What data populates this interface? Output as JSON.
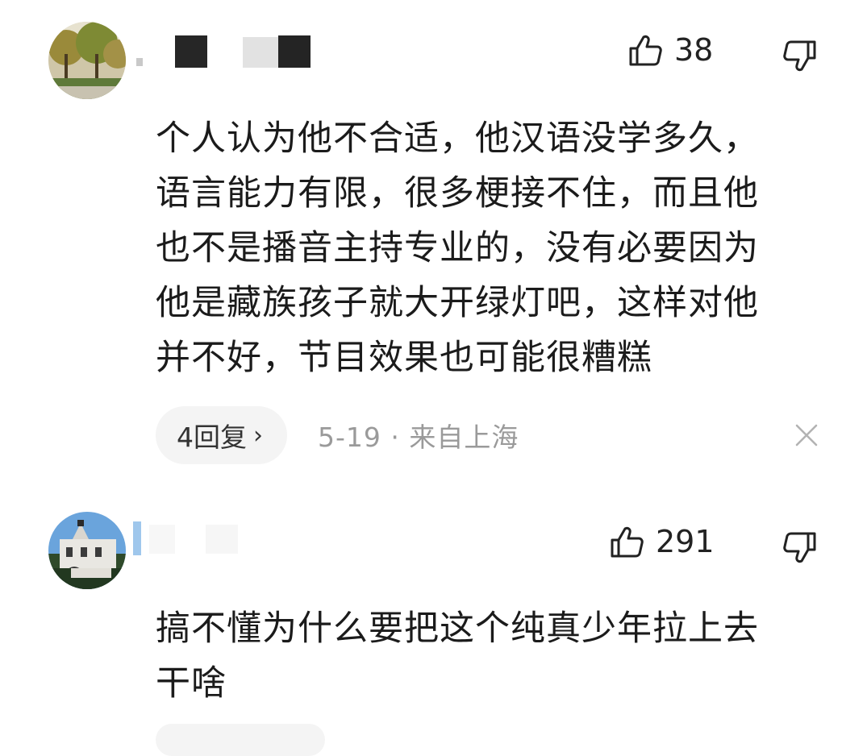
{
  "comments": [
    {
      "username": "",
      "likes": "38",
      "text": "个人认为他不合适，他汉语没学多久，\n语言能力有限，很多梗接不住，而且他\n也不是播音主持专业的，没有必要因为\n他是藏族孩子就大开绿灯吧，这样对他\n并不好，节目效果也可能很糟糕",
      "replies_label": "4回复",
      "reply_chevron": "›",
      "meta": "5-19 · 来自上海",
      "avatar_icon": "tree-photo-avatar"
    },
    {
      "username": "",
      "likes": "291",
      "text": "搞不懂为什么要把这个纯真少年拉上去\n干啥",
      "avatar_icon": "building-photo-avatar"
    }
  ],
  "icons": {
    "like": "thumbs-up-icon",
    "dislike": "thumbs-down-icon",
    "close": "close-icon"
  },
  "colors": {
    "text": "#1b1b1b",
    "meta": "#9a9a9a",
    "pill_bg": "#f4f4f4"
  }
}
